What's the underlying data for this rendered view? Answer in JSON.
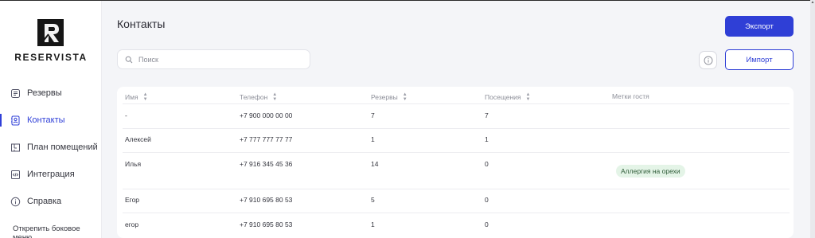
{
  "brand": {
    "name": "RESERVISTA"
  },
  "sidebar": {
    "items": [
      {
        "label": "Резервы",
        "icon": "reservations-icon",
        "active": false
      },
      {
        "label": "Контакты",
        "icon": "contacts-icon",
        "active": true
      },
      {
        "label": "План помещений",
        "icon": "floor-plan-icon",
        "active": false
      },
      {
        "label": "Интеграция",
        "icon": "integration-icon",
        "active": false
      },
      {
        "label": "Справка",
        "icon": "info-icon",
        "active": false
      }
    ],
    "pin_label": "Открепить боковое меню"
  },
  "header": {
    "title": "Контакты",
    "export_label": "Экспорт",
    "import_label": "Импорт"
  },
  "search": {
    "placeholder": "Поиск",
    "value": ""
  },
  "table": {
    "columns": [
      "Имя",
      "Телефон",
      "Резервы",
      "Посещения",
      "Метки гостя"
    ],
    "rows": [
      {
        "name": "-",
        "phone": "+7 900 000 00 00",
        "reserves": "7",
        "visits": "7",
        "tag": ""
      },
      {
        "name": "Алексей",
        "phone": "+7 777 777 77 77",
        "reserves": "1",
        "visits": "1",
        "tag": ""
      },
      {
        "name": "Илья",
        "phone": "+7 916 345 45 36",
        "reserves": "14",
        "visits": "0",
        "tag": "Аллергия на орехи"
      },
      {
        "name": "Егор",
        "phone": "+7 910 695 80 53",
        "reserves": "5",
        "visits": "0",
        "tag": ""
      },
      {
        "name": "егор",
        "phone": "+7 910 695 80 53",
        "reserves": "1",
        "visits": "0",
        "tag": ""
      }
    ]
  },
  "colors": {
    "accent": "#2f3fd6",
    "tag_bg": "#e4f4e7",
    "background": "#f4f5f8"
  }
}
